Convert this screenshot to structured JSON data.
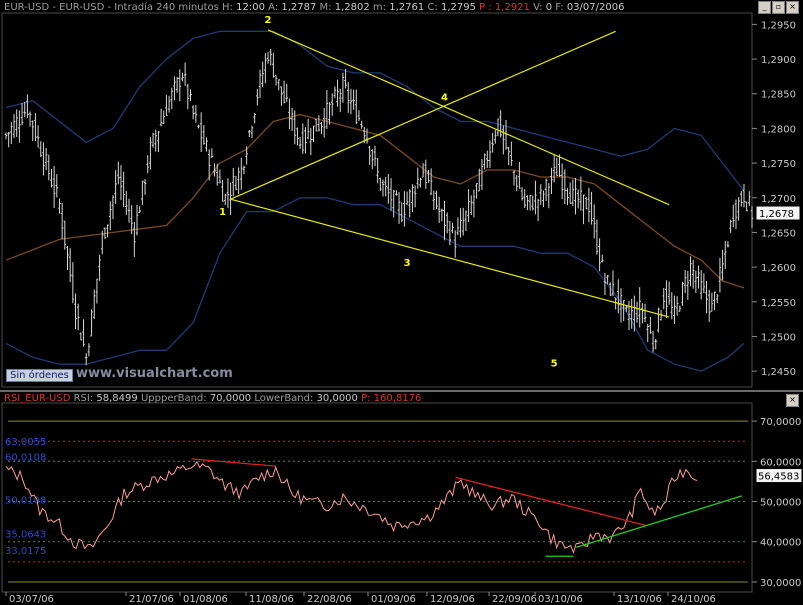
{
  "header": {
    "symbol": "EUR-USD - EUR-USD - Intradía 240 minutos",
    "h_label": "H:",
    "h_value": "12:00",
    "a_label": "A:",
    "a_value": "1,2787",
    "m_label": "M:",
    "m_value": "1,2802",
    "min_label": "m:",
    "min_value": "1,2761",
    "c_label": "C:",
    "c_value": "1,2795",
    "p_label": "P :",
    "p_value": "1,2921",
    "v_label": "V:",
    "v_value": "0",
    "f_label": "F:",
    "f_value": "03/07/2006"
  },
  "rsi_header": {
    "name": "RSI_EUR-USD",
    "rsi_label": "RSI:",
    "rsi_value": "58,8499",
    "upper_label": "UppperBand:",
    "upper_value": "70,0000",
    "lower_label": "LowerBand:",
    "lower_value": "30,0000",
    "p_label": "P:",
    "p_value": "160,8176"
  },
  "badge": "Sin órdenes",
  "watermark": "www.visualchart.com",
  "window_buttons": [
    "_",
    "▫",
    "×"
  ],
  "colors": {
    "background": "#000000",
    "candles": "#d8d8d8",
    "bollinger": "#1e3a78",
    "ma": "#7a4a1e",
    "channel": "#e8e800",
    "rsi": "#ff9999",
    "rsi_trend_red": "#e02020",
    "rsi_trend_green": "#22cc22",
    "wave_labels": "#ffff00"
  },
  "chart_data": [
    {
      "type": "candlestick",
      "title": "EUR-USD Intradía 240 minutos",
      "ylim": [
        1.243,
        1.2965
      ],
      "y_ticks": [
        "1,2950",
        "1,2900",
        "1,2850",
        "1,2800",
        "1,2750",
        "1,2700",
        "1,2650",
        "1,2600",
        "1,2550",
        "1,2500",
        "1,2450"
      ],
      "last_price_label": "1,2678",
      "x_ticks": [
        "03/07/06",
        "21/07/06",
        "01/08/06",
        "11/08/06",
        "22/08/06",
        "01/09/06",
        "12/09/06",
        "22/09/06",
        "03/10/06",
        "13/10/06",
        "24/10/06"
      ],
      "close_path": [
        [
          0,
          1.279
        ],
        [
          8,
          1.283
        ],
        [
          14,
          1.276
        ],
        [
          20,
          1.269
        ],
        [
          26,
          1.254
        ],
        [
          30,
          1.247
        ],
        [
          36,
          1.264
        ],
        [
          42,
          1.273
        ],
        [
          48,
          1.265
        ],
        [
          54,
          1.277
        ],
        [
          60,
          1.283
        ],
        [
          66,
          1.288
        ],
        [
          70,
          1.282
        ],
        [
          76,
          1.276
        ],
        [
          82,
          1.27
        ],
        [
          88,
          1.274
        ],
        [
          94,
          1.285
        ],
        [
          98,
          1.291
        ],
        [
          104,
          1.284
        ],
        [
          110,
          1.278
        ],
        [
          118,
          1.281
        ],
        [
          126,
          1.286
        ],
        [
          134,
          1.28
        ],
        [
          140,
          1.272
        ],
        [
          148,
          1.268
        ],
        [
          156,
          1.274
        ],
        [
          162,
          1.268
        ],
        [
          168,
          1.264
        ],
        [
          174,
          1.269
        ],
        [
          180,
          1.276
        ],
        [
          184,
          1.281
        ],
        [
          188,
          1.276
        ],
        [
          194,
          1.269
        ],
        [
          200,
          1.27
        ],
        [
          206,
          1.274
        ],
        [
          212,
          1.27
        ],
        [
          218,
          1.269
        ],
        [
          224,
          1.258
        ],
        [
          228,
          1.256
        ],
        [
          232,
          1.253
        ],
        [
          238,
          1.254
        ],
        [
          242,
          1.249
        ],
        [
          246,
          1.256
        ],
        [
          250,
          1.253
        ],
        [
          256,
          1.26
        ],
        [
          260,
          1.257
        ],
        [
          264,
          1.254
        ],
        [
          268,
          1.26
        ],
        [
          272,
          1.268
        ],
        [
          276,
          1.2705
        ],
        [
          279,
          1.2678
        ]
      ],
      "moving_average": [
        [
          0,
          1.261
        ],
        [
          20,
          1.264
        ],
        [
          40,
          1.265
        ],
        [
          60,
          1.266
        ],
        [
          70,
          1.27
        ],
        [
          80,
          1.275
        ],
        [
          90,
          1.277
        ],
        [
          100,
          1.281
        ],
        [
          110,
          1.282
        ],
        [
          120,
          1.281
        ],
        [
          130,
          1.28
        ],
        [
          140,
          1.279
        ],
        [
          150,
          1.276
        ],
        [
          160,
          1.273
        ],
        [
          170,
          1.272
        ],
        [
          180,
          1.274
        ],
        [
          190,
          1.274
        ],
        [
          200,
          1.273
        ],
        [
          210,
          1.273
        ],
        [
          220,
          1.272
        ],
        [
          230,
          1.269
        ],
        [
          240,
          1.266
        ],
        [
          250,
          1.263
        ],
        [
          260,
          1.261
        ],
        [
          268,
          1.258
        ],
        [
          276,
          1.257
        ]
      ],
      "bollinger_upper": [
        [
          0,
          1.283
        ],
        [
          10,
          1.284
        ],
        [
          20,
          1.281
        ],
        [
          30,
          1.278
        ],
        [
          40,
          1.28
        ],
        [
          50,
          1.286
        ],
        [
          60,
          1.29
        ],
        [
          70,
          1.293
        ],
        [
          80,
          1.294
        ],
        [
          90,
          1.294
        ],
        [
          100,
          1.294
        ],
        [
          110,
          1.292
        ],
        [
          120,
          1.289
        ],
        [
          130,
          1.288
        ],
        [
          140,
          1.288
        ],
        [
          150,
          1.286
        ],
        [
          160,
          1.283
        ],
        [
          170,
          1.281
        ],
        [
          180,
          1.281
        ],
        [
          190,
          1.28
        ],
        [
          200,
          1.279
        ],
        [
          210,
          1.278
        ],
        [
          220,
          1.277
        ],
        [
          230,
          1.276
        ],
        [
          240,
          1.277
        ],
        [
          250,
          1.28
        ],
        [
          260,
          1.279
        ],
        [
          270,
          1.274
        ],
        [
          276,
          1.271
        ]
      ],
      "bollinger_lower": [
        [
          0,
          1.249
        ],
        [
          10,
          1.247
        ],
        [
          20,
          1.246
        ],
        [
          30,
          1.246
        ],
        [
          40,
          1.247
        ],
        [
          50,
          1.248
        ],
        [
          60,
          1.248
        ],
        [
          70,
          1.252
        ],
        [
          80,
          1.262
        ],
        [
          90,
          1.268
        ],
        [
          100,
          1.268
        ],
        [
          110,
          1.27
        ],
        [
          120,
          1.27
        ],
        [
          130,
          1.269
        ],
        [
          140,
          1.269
        ],
        [
          150,
          1.267
        ],
        [
          160,
          1.265
        ],
        [
          170,
          1.263
        ],
        [
          180,
          1.263
        ],
        [
          190,
          1.263
        ],
        [
          200,
          1.262
        ],
        [
          210,
          1.262
        ],
        [
          220,
          1.26
        ],
        [
          230,
          1.255
        ],
        [
          240,
          1.248
        ],
        [
          250,
          1.246
        ],
        [
          260,
          1.245
        ],
        [
          270,
          1.247
        ],
        [
          276,
          1.249
        ]
      ],
      "channel_lines": [
        {
          "from": [
            84,
            1.2698
          ],
          "to": [
            248,
            1.2528
          ]
        },
        {
          "from": [
            98,
            1.2942
          ],
          "to": [
            248,
            1.269
          ]
        },
        {
          "from": [
            84,
            1.2698
          ],
          "to": [
            228,
            1.294
          ]
        }
      ],
      "wave_labels": [
        {
          "label": "1",
          "x": 84,
          "y": 1.2698
        },
        {
          "label": "2",
          "x": 98,
          "y": 1.2942
        },
        {
          "label": "3",
          "x": 150,
          "y": 1.2625
        },
        {
          "label": "4",
          "x": 164,
          "y": 1.283
        },
        {
          "label": "5",
          "x": 205,
          "y": 1.248
        }
      ]
    },
    {
      "type": "line",
      "title": "RSI_EUR-USD",
      "ylim": [
        28,
        74
      ],
      "y_ticks": [
        "70,0000",
        "60,0000",
        "50,0000",
        "40,0000",
        "30,0000"
      ],
      "last_value_label": "56,4583",
      "left_labels": [
        "63,0055",
        "60,0108",
        "50,0108",
        "35,0643",
        "33,0175"
      ],
      "upper_band": 70,
      "lower_band": 30,
      "reference_levels": [
        65,
        60,
        50,
        40,
        35
      ],
      "series": [
        {
          "values": [
            [
              0,
              58
            ],
            [
              6,
              56
            ],
            [
              12,
              48
            ],
            [
              18,
              45
            ],
            [
              24,
              40
            ],
            [
              30,
              38
            ],
            [
              36,
              44
            ],
            [
              42,
              52
            ],
            [
              48,
              54
            ],
            [
              54,
              56
            ],
            [
              60,
              57
            ],
            [
              66,
              59
            ],
            [
              72,
              58
            ],
            [
              78,
              54
            ],
            [
              84,
              52
            ],
            [
              90,
              56
            ],
            [
              96,
              58
            ],
            [
              102,
              52
            ],
            [
              108,
              50
            ],
            [
              114,
              49
            ],
            [
              120,
              51
            ],
            [
              126,
              49
            ],
            [
              132,
              47
            ],
            [
              138,
              44
            ],
            [
              144,
              45
            ],
            [
              150,
              46
            ],
            [
              156,
              50
            ],
            [
              162,
              55
            ],
            [
              168,
              51
            ],
            [
              174,
              49
            ],
            [
              180,
              51
            ],
            [
              186,
              47
            ],
            [
              190,
              45
            ],
            [
              194,
              41
            ],
            [
              198,
              39
            ],
            [
              204,
              38
            ],
            [
              210,
              42
            ],
            [
              216,
              41
            ],
            [
              222,
              46
            ],
            [
              226,
              53
            ],
            [
              230,
              47
            ],
            [
              234,
              49
            ],
            [
              238,
              56
            ],
            [
              242,
              58
            ],
            [
              246,
              56
            ]
          ]
        }
      ],
      "trend_lines": [
        {
          "color": "red",
          "from": [
            66,
            60.6
          ],
          "to": [
            96,
            58.8
          ]
        },
        {
          "color": "red",
          "from": [
            160,
            56.0
          ],
          "to": [
            228,
            44.0
          ]
        },
        {
          "color": "green",
          "from": [
            203,
            38.6
          ],
          "to": [
            262,
            51.4
          ]
        },
        {
          "color": "green",
          "from": [
            192,
            36.4
          ],
          "to": [
            202,
            36.4
          ]
        }
      ]
    }
  ]
}
